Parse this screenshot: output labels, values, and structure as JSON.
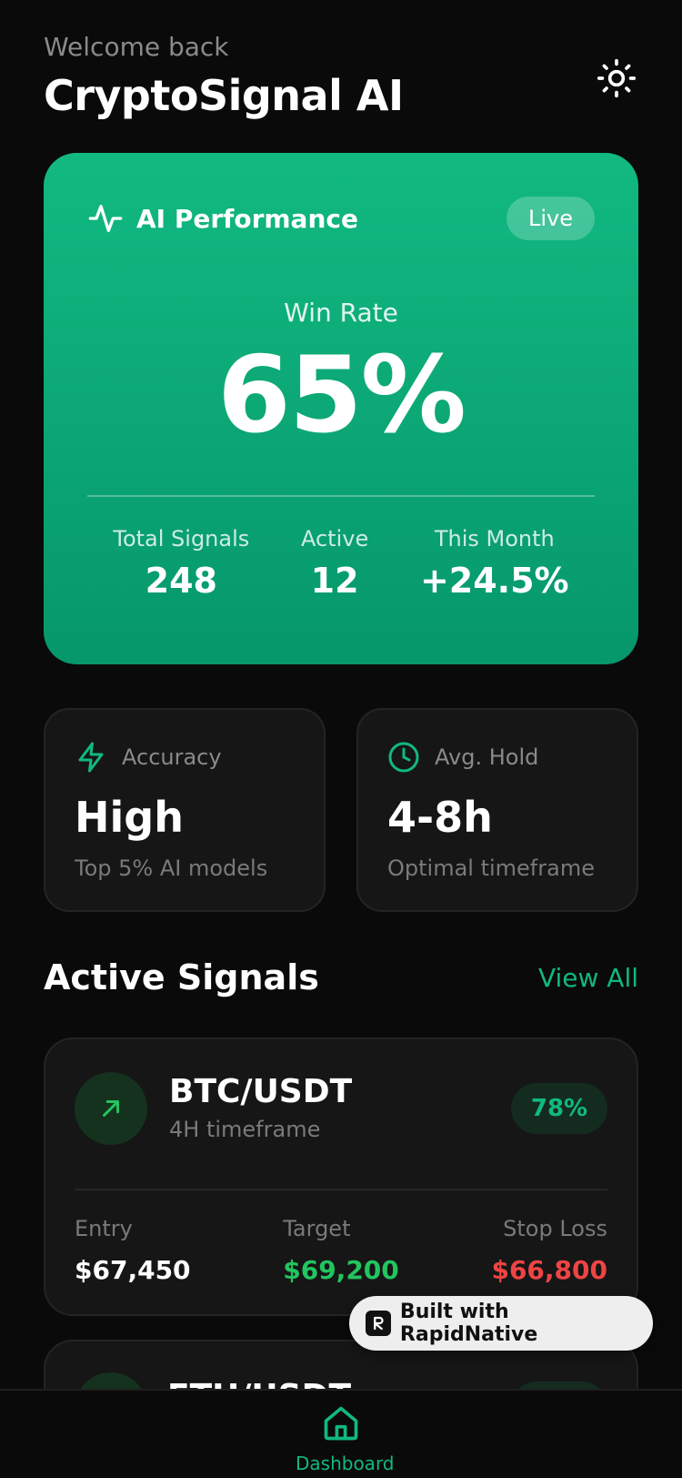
{
  "header": {
    "welcome": "Welcome back",
    "title": "CryptoSignal AI"
  },
  "performance": {
    "title": "AI Performance",
    "badge": "Live",
    "win_rate_label": "Win Rate",
    "win_rate_value": "65%",
    "stats": [
      {
        "label": "Total Signals",
        "value": "248"
      },
      {
        "label": "Active",
        "value": "12"
      },
      {
        "label": "This Month",
        "value": "+24.5%"
      }
    ]
  },
  "cards": {
    "accuracy": {
      "label": "Accuracy",
      "value": "High",
      "sub": "Top 5% AI models"
    },
    "hold": {
      "label": "Avg. Hold",
      "value": "4-8h",
      "sub": "Optimal timeframe"
    }
  },
  "signals_section": {
    "title": "Active Signals",
    "view_all": "View All",
    "items": [
      {
        "pair": "BTC/USDT",
        "timeframe": "4H timeframe",
        "confidence": "78%",
        "entry_label": "Entry",
        "entry": "$67,450",
        "target_label": "Target",
        "target": "$69,200",
        "stop_label": "Stop Loss",
        "stop": "$66,800"
      },
      {
        "pair": "ETH/USDT"
      }
    ]
  },
  "built_with": "Built with RapidNative",
  "nav": {
    "dashboard": "Dashboard"
  },
  "colors": {
    "accent": "#10b981",
    "green": "#22c55e",
    "red": "#ef4444",
    "background": "#0a0a0a",
    "card": "#161616"
  },
  "icons": {
    "theme": "sun-icon",
    "performance": "activity-pulse-icon",
    "accuracy": "lightning-bolt-icon",
    "hold": "clock-icon",
    "signal": "arrow-up-right-icon",
    "nav": "home-icon",
    "brand": "rapidnative-logo-icon"
  }
}
